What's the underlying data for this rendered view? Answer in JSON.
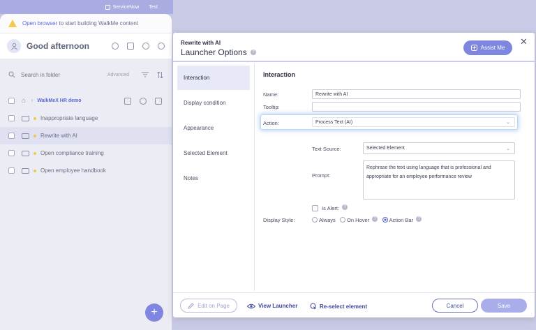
{
  "topbar": {
    "app_name": "ServiceNow",
    "env": "Test"
  },
  "left_panel": {
    "banner_link": "Open browser",
    "banner_text": "to start building WalkMe content",
    "greeting": "Good afternoon",
    "search_placeholder": "Search in folder",
    "advanced_label": "Advanced",
    "breadcrumb": "WalkMeX HR demo",
    "items": [
      {
        "label": "Inappropriate language"
      },
      {
        "label": "Rewrite with AI"
      },
      {
        "label": "Open compliance training"
      },
      {
        "label": "Open employee handbook"
      }
    ],
    "add_button": "+"
  },
  "dialog": {
    "subtitle": "Rewrite with AI",
    "title": "Launcher Options",
    "help_glyph": "?",
    "assist_label": "Assist Me",
    "close_glyph": "✕",
    "nav": [
      "Interaction",
      "Display condition",
      "Appearance",
      "Selected Element",
      "Notes"
    ],
    "form": {
      "section_title": "Interaction",
      "name_label": "Name:",
      "name_value": "Rewrite with AI",
      "tooltip_label": "Tooltip:",
      "tooltip_value": "",
      "action_label": "Action:",
      "action_value": "Process Text (AI)",
      "text_source_label": "Text Source:",
      "text_source_value": "Selected Element",
      "prompt_label": "Prompt:",
      "prompt_value": "Rephrase the text using language that is professional and appropriate for an employee performance review",
      "is_alert_label": "Is Alert:",
      "display_style_label": "Display Style:",
      "display_options": [
        "Always",
        "On Hover",
        "Action Bar"
      ],
      "display_selected": "Action Bar"
    },
    "footer": {
      "edit_label": "Edit on Page",
      "view_label": "View Launcher",
      "reselect_label": "Re-select element",
      "cancel_label": "Cancel",
      "save_label": "Save"
    }
  }
}
